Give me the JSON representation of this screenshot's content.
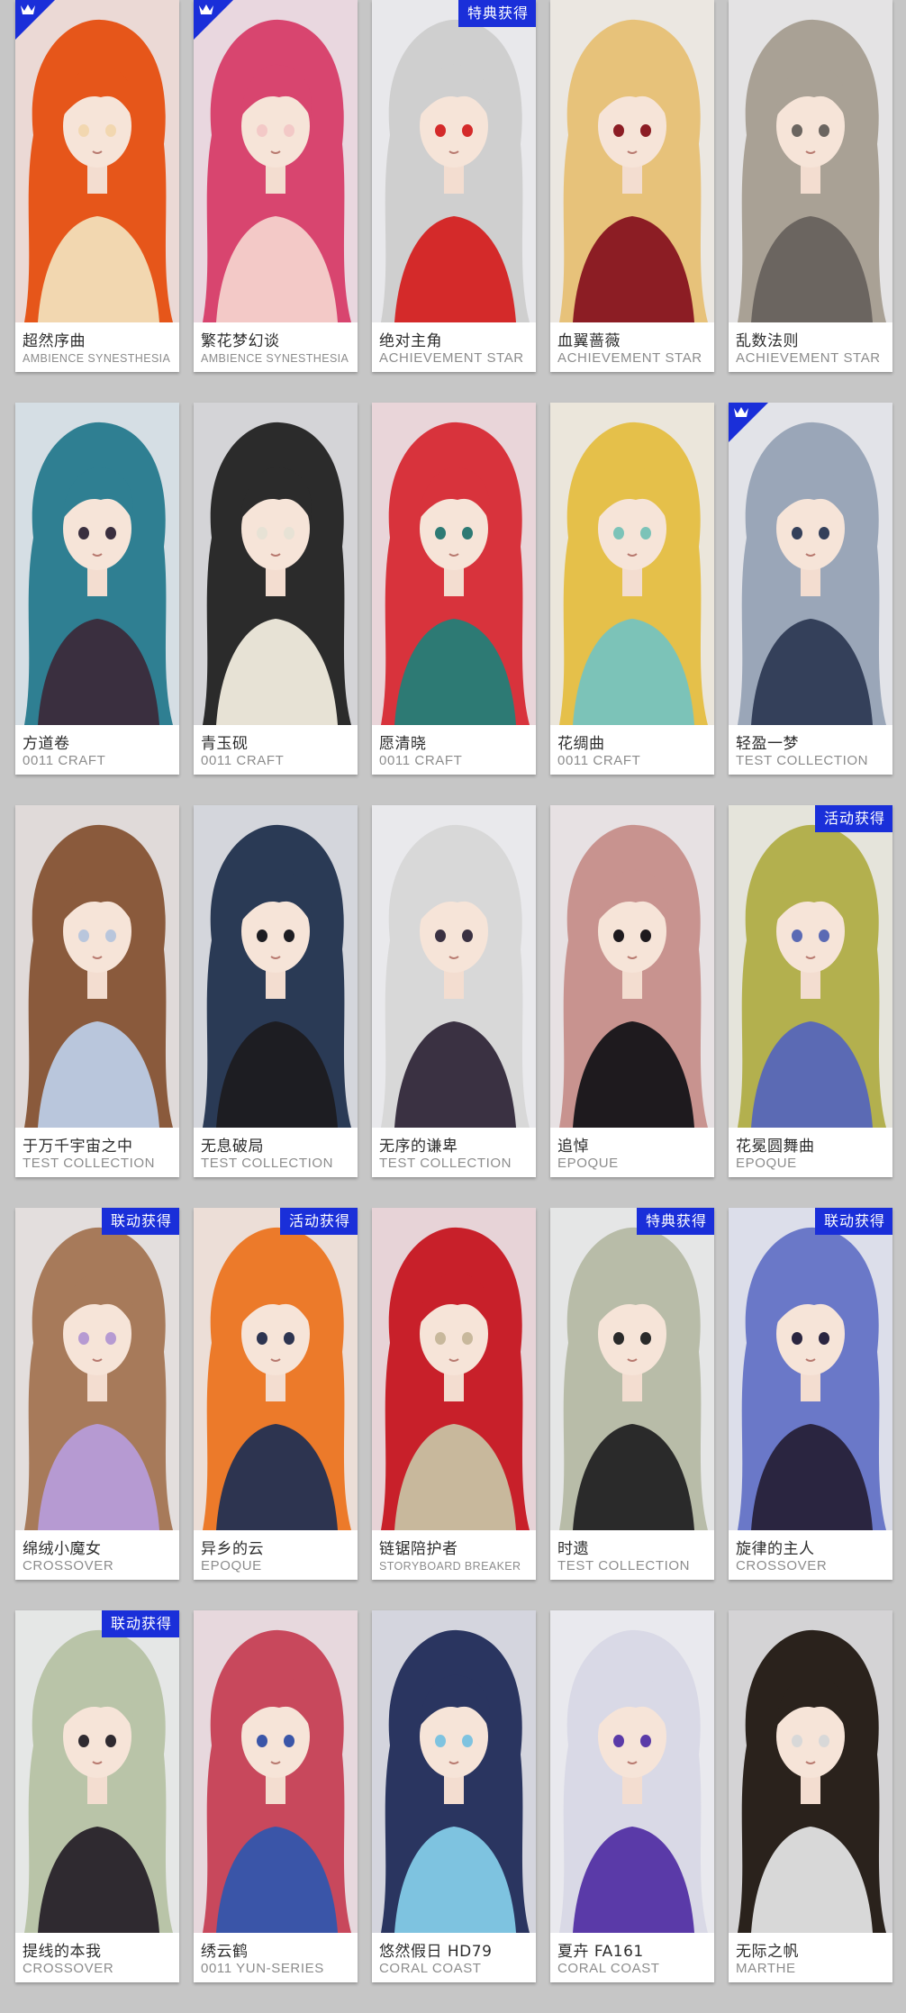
{
  "colors": {
    "page_background": "#c6c6c6",
    "badge": "#1a2fd9",
    "name_text": "#2d2d2d",
    "series_text": "#8c8c8c"
  },
  "rows": [
    [
      {
        "name": "超然序曲",
        "series": "AMBIENCE SYNESTHESIA",
        "badge": "",
        "corner": true,
        "hair": "#e6561a",
        "accent": "#f2d7b0"
      },
      {
        "name": "繁花梦幻谈",
        "series": "AMBIENCE SYNESTHESIA",
        "badge": "",
        "corner": true,
        "hair": "#d8456f",
        "accent": "#f3c9c7"
      },
      {
        "name": "绝对主角",
        "series": "ACHIEVEMENT STAR",
        "badge": "特典获得",
        "corner": false,
        "hair": "#cfcfcf",
        "accent": "#d42a2a"
      },
      {
        "name": "血翼蔷薇",
        "series": "ACHIEVEMENT STAR",
        "badge": "",
        "corner": false,
        "hair": "#e7c27a",
        "accent": "#8c1d24"
      },
      {
        "name": "乱数法则",
        "series": "ACHIEVEMENT STAR",
        "badge": "",
        "corner": false,
        "hair": "#a9a195",
        "accent": "#6b6560"
      }
    ],
    [
      {
        "name": "方道卷",
        "series": "0011 CRAFT",
        "badge": "",
        "corner": false,
        "hair": "#2f7f92",
        "accent": "#3a2f3f"
      },
      {
        "name": "青玉砚",
        "series": "0011 CRAFT",
        "badge": "",
        "corner": false,
        "hair": "#2b2b2b",
        "accent": "#e7e2d5"
      },
      {
        "name": "愿清晓",
        "series": "0011 CRAFT",
        "badge": "",
        "corner": false,
        "hair": "#d8333c",
        "accent": "#2d7a74"
      },
      {
        "name": "花绸曲",
        "series": "0011 CRAFT",
        "badge": "",
        "corner": false,
        "hair": "#e5c04a",
        "accent": "#7cc3b8"
      },
      {
        "name": "轻盈一梦",
        "series": "TEST COLLECTION",
        "badge": "",
        "corner": true,
        "hair": "#9aa6b8",
        "accent": "#34405a"
      }
    ],
    [
      {
        "name": "于万千宇宙之中",
        "series": "TEST COLLECTION",
        "badge": "",
        "corner": false,
        "hair": "#8a5a3c",
        "accent": "#b9c6dc"
      },
      {
        "name": "无息破局",
        "series": "TEST COLLECTION",
        "badge": "",
        "corner": false,
        "hair": "#2a3a55",
        "accent": "#1d1d22"
      },
      {
        "name": "无序的谦卑",
        "series": "TEST COLLECTION",
        "badge": "",
        "corner": false,
        "hair": "#d8d8d8",
        "accent": "#3a3142"
      },
      {
        "name": "追悼",
        "series": "EPOQUE",
        "badge": "",
        "corner": false,
        "hair": "#c8938f",
        "accent": "#1e1a1e"
      },
      {
        "name": "花冕圆舞曲",
        "series": "EPOQUE",
        "badge": "活动获得",
        "corner": false,
        "hair": "#b3b04e",
        "accent": "#5b6ab4"
      }
    ],
    [
      {
        "name": "绵绒小魔女",
        "series": "CROSSOVER",
        "badge": "联动获得",
        "corner": false,
        "hair": "#a77a5a",
        "accent": "#b69ad2"
      },
      {
        "name": "异乡的云",
        "series": "EPOQUE",
        "badge": "活动获得",
        "corner": false,
        "hair": "#ec7a2a",
        "accent": "#2d3450"
      },
      {
        "name": "链锯陪护者",
        "series": "STORYBOARD BREAKER",
        "badge": "",
        "corner": false,
        "hair": "#c8202a",
        "accent": "#c8b89c"
      },
      {
        "name": "时遗",
        "series": "TEST COLLECTION",
        "badge": "特典获得",
        "corner": false,
        "hair": "#b8bca8",
        "accent": "#2a2a2a"
      },
      {
        "name": "旋律的主人",
        "series": "CROSSOVER",
        "badge": "联动获得",
        "corner": false,
        "hair": "#6a78c8",
        "accent": "#2a2540"
      }
    ],
    [
      {
        "name": "提线的本我",
        "series": "CROSSOVER",
        "badge": "联动获得",
        "corner": false,
        "hair": "#b9c4a8",
        "accent": "#2f2a30"
      },
      {
        "name": "绣云鹤",
        "series": "0011 YUN-SERIES",
        "badge": "",
        "corner": false,
        "hair": "#c8485c",
        "accent": "#3a55a8"
      },
      {
        "name": "悠然假日 HD79",
        "series": "CORAL COAST",
        "badge": "",
        "corner": false,
        "hair": "#2a3560",
        "accent": "#7ec3e0"
      },
      {
        "name": "夏卉 FA161",
        "series": "CORAL COAST",
        "badge": "",
        "corner": false,
        "hair": "#d9d9e6",
        "accent": "#5a3aa8"
      },
      {
        "name": "无际之帆",
        "series": "MARTHE",
        "badge": "",
        "corner": false,
        "hair": "#2a221c",
        "accent": "#d8d8d8"
      }
    ]
  ]
}
